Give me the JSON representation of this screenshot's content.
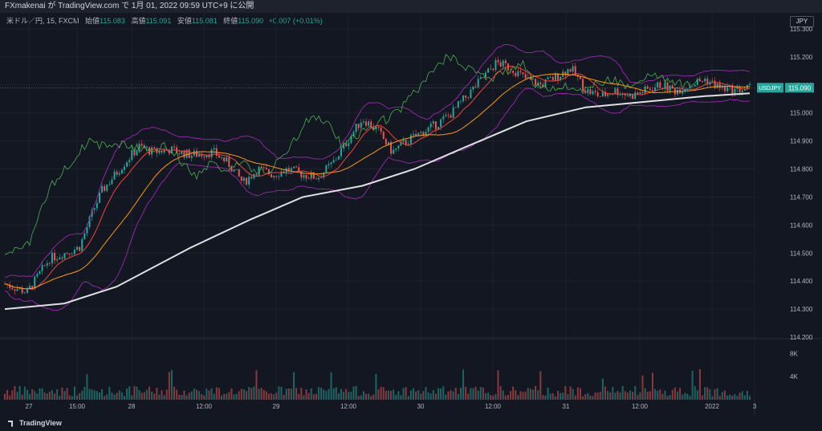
{
  "header": {
    "published": "FXmakenai が TradingView.com で 1月 01, 2022 09:59 UTC+9 に公開"
  },
  "legend": {
    "symbol": "米ドル／円, 15, FXCM",
    "open_label": "始値",
    "open": "115.083",
    "high_label": "高値",
    "high": "115.091",
    "low_label": "安値",
    "low": "115.081",
    "close_label": "終値",
    "close": "115.090",
    "change": "+0.007 (+0.01%)"
  },
  "currency_tag": "JPY",
  "price_label": {
    "symbol": "USDJPY",
    "price": "115.090"
  },
  "footer": {
    "brand": "TradingView"
  },
  "colors": {
    "background": "#131722",
    "up": "#26a69a",
    "down": "#ef5350",
    "bollinger": "#9c27b0",
    "ema_fast": "#f44336",
    "ema_mid": "#ff9800",
    "sma_long": "#e0e0e0",
    "chikou": "#4caf50"
  },
  "chart_data": {
    "type": "candlestick",
    "y_ticks": [
      "115.300",
      "115.200",
      "115.100",
      "115.000",
      "114.900",
      "114.800",
      "114.700",
      "114.600",
      "114.500",
      "114.400",
      "114.300",
      "114.200"
    ],
    "ylim": [
      114.2,
      115.3
    ],
    "volume_ticks": [
      "8K",
      "4K"
    ],
    "x_ticks": [
      "27",
      "15:00",
      "28",
      "12:00",
      "29",
      "12:00",
      "30",
      "12:00",
      "31",
      "12:00",
      "2022",
      "3"
    ],
    "close_path": [
      [
        0,
        114.39
      ],
      [
        3,
        114.36
      ],
      [
        4,
        114.4
      ],
      [
        6,
        114.48
      ],
      [
        8,
        114.5
      ],
      [
        10,
        114.52
      ],
      [
        12,
        114.66
      ],
      [
        13,
        114.72
      ],
      [
        16,
        114.82
      ],
      [
        18,
        114.88
      ],
      [
        20,
        114.86
      ],
      [
        22,
        114.87
      ],
      [
        25,
        114.85
      ],
      [
        28,
        114.86
      ],
      [
        30,
        114.82
      ],
      [
        32,
        114.75
      ],
      [
        34,
        114.8
      ],
      [
        36,
        114.78
      ],
      [
        38,
        114.8
      ],
      [
        40,
        114.78
      ],
      [
        42,
        114.77
      ],
      [
        44,
        114.82
      ],
      [
        46,
        114.9
      ],
      [
        48,
        114.98
      ],
      [
        50,
        114.94
      ],
      [
        52,
        114.86
      ],
      [
        54,
        114.9
      ],
      [
        56,
        114.93
      ],
      [
        58,
        114.96
      ],
      [
        60,
        115.0
      ],
      [
        62,
        115.06
      ],
      [
        64,
        115.12
      ],
      [
        66,
        115.18
      ],
      [
        68,
        115.16
      ],
      [
        70,
        115.12
      ],
      [
        72,
        115.1
      ],
      [
        74,
        115.13
      ],
      [
        76,
        115.16
      ],
      [
        78,
        115.08
      ],
      [
        80,
        115.06
      ],
      [
        82,
        115.08
      ],
      [
        84,
        115.06
      ],
      [
        86,
        115.08
      ],
      [
        88,
        115.1
      ],
      [
        90,
        115.08
      ],
      [
        92,
        115.1
      ],
      [
        94,
        115.12
      ],
      [
        96,
        115.09
      ],
      [
        98,
        115.08
      ],
      [
        100,
        115.09
      ]
    ],
    "sma_long_path": [
      [
        0,
        114.3
      ],
      [
        8,
        114.32
      ],
      [
        15,
        114.38
      ],
      [
        25,
        114.52
      ],
      [
        33,
        114.62
      ],
      [
        40,
        114.7
      ],
      [
        48,
        114.74
      ],
      [
        55,
        114.8
      ],
      [
        62,
        114.88
      ],
      [
        70,
        114.97
      ],
      [
        78,
        115.02
      ],
      [
        86,
        115.04
      ],
      [
        94,
        115.06
      ],
      [
        100,
        115.07
      ]
    ],
    "current_price": 115.09
  }
}
